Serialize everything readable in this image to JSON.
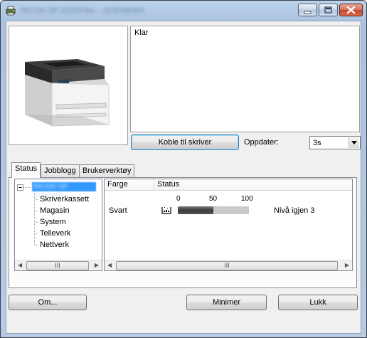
{
  "window": {
    "title": "RICOH SP 220SFNw - 1E4D4B484"
  },
  "status": {
    "message": "Klar"
  },
  "connect_button": "Koble til skriver",
  "refresh": {
    "label": "Oppdater:",
    "value": "3s"
  },
  "tabs": [
    {
      "label": "Status",
      "active": true
    },
    {
      "label": "Jobblogg",
      "active": false
    },
    {
      "label": "Brukerverktøy",
      "active": false
    }
  ],
  "tree": {
    "root": "RICOH SP 220SFNw",
    "items": [
      "Skriverkassett",
      "Magasin",
      "System",
      "Telleverk",
      "Nettverk"
    ]
  },
  "list": {
    "columns": [
      "Farge",
      "Status"
    ],
    "scale": [
      "0",
      "50",
      "100"
    ],
    "rows": [
      {
        "color": "Svart",
        "level_percent": 50,
        "remaining": "Nivå igjen 3"
      }
    ]
  },
  "scrollbar_thumb": "III",
  "buttons": {
    "about": "Om...",
    "minimize": "Minimer",
    "close": "Lukk"
  },
  "colors": {
    "selection": "#3399ff",
    "close_button": "#c2472c"
  }
}
